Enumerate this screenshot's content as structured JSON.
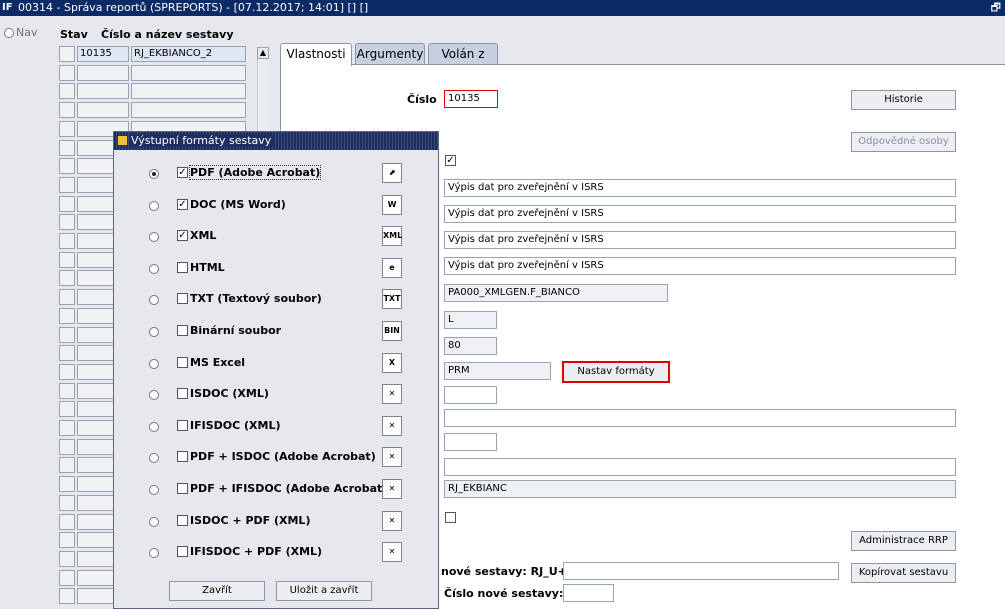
{
  "window": {
    "logo": "IF",
    "title": "00314 - Správa reportů (SPREPORTS) - [07.12.2017; 14:01] [] []",
    "restore_icon": "restore-window-icon"
  },
  "nav": {
    "label": "Nav"
  },
  "grid": {
    "header_stav": "Stav",
    "header_cislo": "Číslo a název sestavy",
    "first_row": {
      "cislo": "10135",
      "nazev": "RJ_EKBIANCO_2"
    }
  },
  "tabs": [
    {
      "label": "Vlastnosti",
      "active": true
    },
    {
      "label": "Argumenty",
      "active": false
    },
    {
      "label": "Volán z",
      "active": false
    }
  ],
  "form": {
    "cislo_label": "Číslo",
    "cislo_value": "10135",
    "historie_btn": "Historie",
    "odpovedne_btn": "Odpovědné osoby",
    "fields": [
      "Výpis dat pro zveřejnění v ISRS",
      "Výpis dat pro zveřejnění v ISRS",
      "Výpis dat pro zveřejnění v ISRS",
      "Výpis dat pro zveřejnění v ISRS"
    ],
    "procedure": "PA000_XMLGEN.F_BIANCO",
    "orientation": "L",
    "size": "80",
    "format": "PRM",
    "nastav_btn": "Nastav formáty",
    "report_name": "RJ_EKBIANC",
    "admin_btn": "Administrace RRP",
    "nove_label": "nové sestavy: RJ_U+",
    "kopirovat_btn": "Kopírovat sestavu",
    "cislo_nove_label": "Číslo nové sestavy:"
  },
  "dialog": {
    "title": "Výstupní formáty sestavy",
    "formats": [
      {
        "label": "PDF (Adobe Acrobat)",
        "checked": true,
        "default": true,
        "icon": "pdf-icon",
        "glyph": "⬈"
      },
      {
        "label": "DOC (MS Word)",
        "checked": true,
        "default": false,
        "icon": "word-icon",
        "glyph": "W"
      },
      {
        "label": "XML",
        "checked": true,
        "default": false,
        "icon": "xml-icon",
        "glyph": "XML"
      },
      {
        "label": "HTML",
        "checked": false,
        "default": false,
        "icon": "html-icon",
        "glyph": "e"
      },
      {
        "label": "TXT (Textový soubor)",
        "checked": false,
        "default": false,
        "icon": "txt-icon",
        "glyph": "TXT"
      },
      {
        "label": "Binární soubor",
        "checked": false,
        "default": false,
        "icon": "binary-icon",
        "glyph": "BIN"
      },
      {
        "label": "MS Excel",
        "checked": false,
        "default": false,
        "icon": "excel-icon",
        "glyph": "X"
      },
      {
        "label": "ISDOC (XML)",
        "checked": false,
        "default": false,
        "icon": "isdoc-icon",
        "glyph": "✕"
      },
      {
        "label": "IFISDOC (XML)",
        "checked": false,
        "default": false,
        "icon": "ifisdoc-icon",
        "glyph": "✕"
      },
      {
        "label": "PDF + ISDOC (Adobe Acrobat)",
        "checked": false,
        "default": false,
        "icon": "pdf-isdoc-icon",
        "glyph": "✕"
      },
      {
        "label": "PDF + IFISDOC (Adobe Acrobat)",
        "checked": false,
        "default": false,
        "icon": "pdf-ifisdoc-icon",
        "glyph": "✕"
      },
      {
        "label": "ISDOC + PDF (XML)",
        "checked": false,
        "default": false,
        "icon": "isdoc-pdf-icon",
        "glyph": "✕"
      },
      {
        "label": "IFISDOC + PDF (XML)",
        "checked": false,
        "default": false,
        "icon": "ifisdoc-pdf-icon",
        "glyph": "✕"
      }
    ],
    "close_btn": "Zavřít",
    "save_close_btn": "Uložit a zavřít"
  },
  "colors": {
    "accent": "#0c2a66",
    "highlight": "#e00000"
  }
}
